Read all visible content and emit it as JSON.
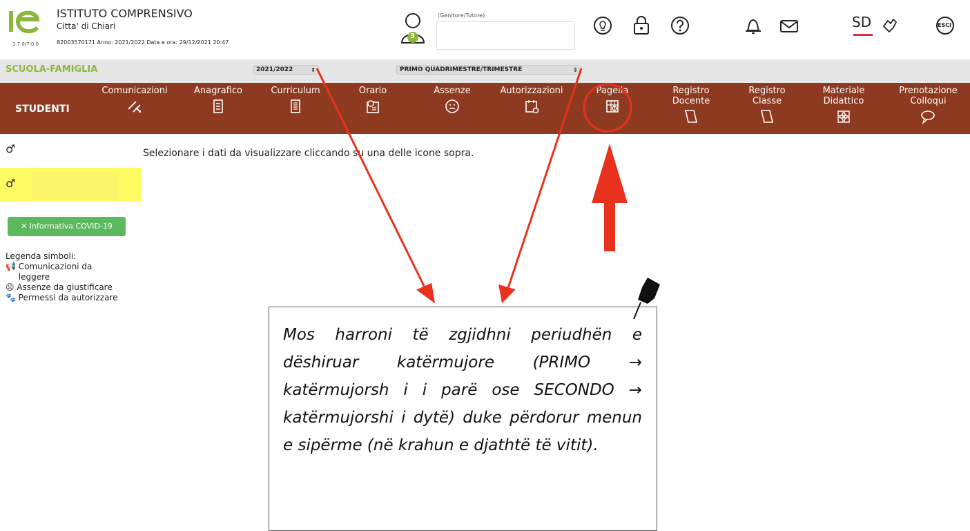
{
  "header": {
    "version": "1.7.0/7.0.0",
    "institute_title": "ISTITUTO COMPRENSIVO",
    "institute_city": "Citta' di Chiari",
    "institute_info": "82003570171   Anno: 2021/2022  Data e ora: 29/12/2021 20:47",
    "user_role": "(Genitore/Tutore)",
    "user_badge": "3",
    "logout_label": "ESCI",
    "sd_label": "SD",
    "icons": [
      "lightbulb-icon",
      "lock-icon",
      "help-icon",
      "bell-icon",
      "mail-icon",
      "sd-icon",
      "hand-icon",
      "logout-icon"
    ]
  },
  "bar": {
    "title": "SCUOLA-FAMIGLIA",
    "year_select": "2021/2022",
    "period_select": "PRIMO QUADRIMESTRE/TRIMESTRE"
  },
  "menu": {
    "studenti": "STUDENTI",
    "items": [
      {
        "label": "Comunicazioni",
        "label2": "",
        "icon": "megaphone-icon"
      },
      {
        "label": "Anagrafico",
        "label2": "",
        "icon": "document-icon"
      },
      {
        "label": "Curriculum",
        "label2": "",
        "icon": "document-list-icon"
      },
      {
        "label": "Orario",
        "label2": "",
        "icon": "clock-calendar-icon"
      },
      {
        "label": "Assenze",
        "label2": "",
        "icon": "sad-face-icon"
      },
      {
        "label": "Autorizzazioni",
        "label2": "",
        "icon": "calendar-check-icon"
      },
      {
        "label": "Pagella",
        "label2": "",
        "icon": "report-card-icon"
      },
      {
        "label": "Registro",
        "label2": "Docente",
        "icon": "book-icon"
      },
      {
        "label": "Registro",
        "label2": "Classe",
        "icon": "book-icon"
      },
      {
        "label": "Materiale",
        "label2": "Didattico",
        "icon": "puzzle-icon"
      },
      {
        "label": "Prenotazione",
        "label2": "Colloqui",
        "icon": "speech-icon"
      }
    ]
  },
  "left": {
    "male_symbol": "♂",
    "covid_button": "✕ Informativa COVID-19",
    "legend_title": "Legenda simboli:",
    "legend_items": [
      {
        "icon": "megaphone-icon",
        "symbol": "📢",
        "text": "Comunicazioni da leggere"
      },
      {
        "icon": "frown-icon",
        "symbol": "☹",
        "text": "Assenze da giustificare"
      },
      {
        "icon": "paw-icon",
        "symbol": "🐾",
        "text": "Permessi da autorizzare"
      }
    ]
  },
  "main": {
    "message": "Selezionare i dati da visualizzare cliccando su una delle icone sopra."
  },
  "note": {
    "text": "Mos harroni të zgjidhni periudhën e dëshiruar katërmujore (PRIMO → katërmujorsh i i parë ose SECONDO → katërmujorshi i dytë) duke përdorur menun e sipërme (në krahun e djathtë të vitit)."
  },
  "colors": {
    "menu_bg": "#8d3a20",
    "bar_title": "#8bb83c",
    "highlight": "#fdfd63",
    "covid_button": "#5cb85c",
    "annotation": "#e8321e"
  }
}
